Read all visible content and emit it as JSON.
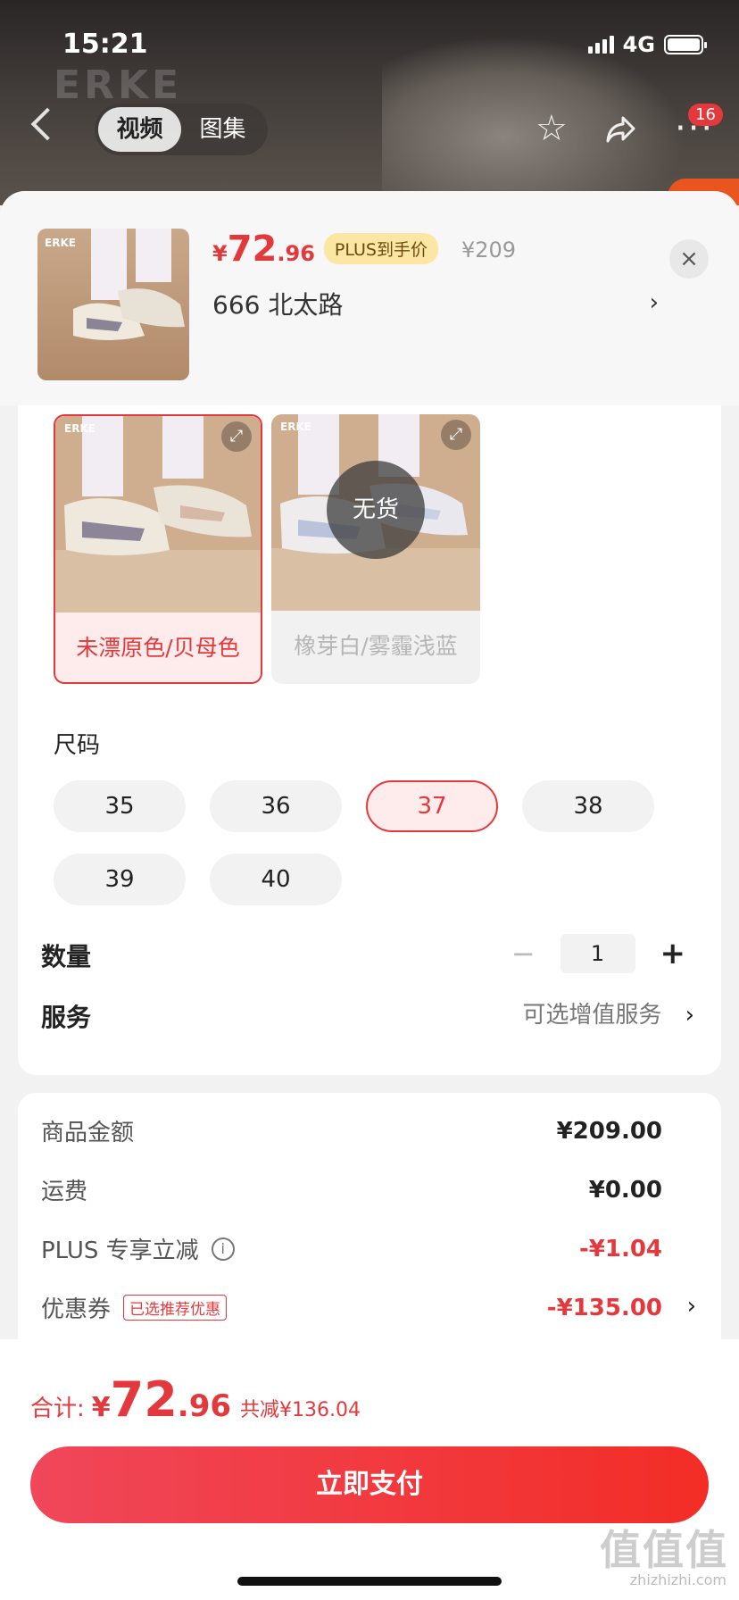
{
  "status_bar": {
    "time": "15:21",
    "network": "4G"
  },
  "nav": {
    "tabs": [
      {
        "label": "视频",
        "active": true
      },
      {
        "label": "图集",
        "active": false
      }
    ],
    "badge_count": "16",
    "icons": [
      "back-icon",
      "star-icon",
      "share-icon",
      "more-icon"
    ]
  },
  "background": {
    "brand_text": "ERKE"
  },
  "product": {
    "price_symbol": "¥",
    "price_int": "72",
    "price_dec": ".96",
    "plus_tag": "PLUS到手价",
    "original_price": "¥209",
    "address": "666  北太路",
    "address_arrow": "›",
    "close": "×"
  },
  "colors": [
    {
      "label": "未漂原色/贝母色",
      "selected": true,
      "available": true
    },
    {
      "label": "橡芽白/雾霾浅蓝",
      "selected": false,
      "available": false,
      "status": "无货"
    }
  ],
  "size": {
    "title": "尺码",
    "options": [
      {
        "label": "35",
        "selected": false
      },
      {
        "label": "36",
        "selected": false
      },
      {
        "label": "37",
        "selected": true
      },
      {
        "label": "38",
        "selected": false
      },
      {
        "label": "39",
        "selected": false
      },
      {
        "label": "40",
        "selected": false
      }
    ]
  },
  "quantity": {
    "label": "数量",
    "minus": "−",
    "value": "1",
    "plus": "+"
  },
  "service": {
    "label": "服务",
    "value": "可选增值服务",
    "arrow": "›"
  },
  "fees": {
    "goods_label": "商品金额",
    "goods_value": "¥209.00",
    "shipping_label": "运费",
    "shipping_value": "¥0.00",
    "plus_label": "PLUS 专享立减",
    "plus_value": "-¥1.04",
    "info_icon": "i",
    "coupon_label": "优惠券",
    "coupon_tag": "已选推荐优惠",
    "coupon_value": "-¥135.00",
    "coupon_arrow": "›"
  },
  "total": {
    "label": "合计:",
    "symbol": "¥",
    "int": "72",
    "dec": ".96",
    "saved": "共减¥136.04"
  },
  "pay_button": "立即支付",
  "watermark": {
    "main": "值值值",
    "sub": "zhizhizhi.com"
  },
  "colors_theme": {
    "accent": "#e4393c",
    "plus_tag_bg": "#fbe6a4",
    "pay_gradient_start": "#f0475a",
    "pay_gradient_end": "#f32d26"
  }
}
